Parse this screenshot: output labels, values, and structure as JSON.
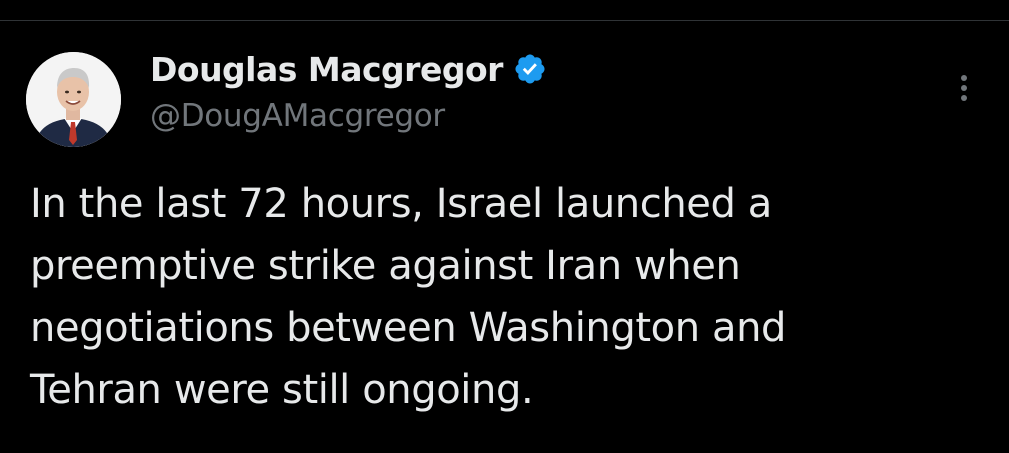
{
  "tweet": {
    "author": {
      "display_name": "Douglas Macgregor",
      "handle": "@DougAMacgregor",
      "verified": true,
      "avatar_icon": "profile-photo"
    },
    "text": "In the last 72 hours, Israel launched a\npreemptive strike against Iran when\nnegotiations between Washington and\nTehran were still ongoing.",
    "more_icon": "vertical-ellipsis-icon"
  },
  "colors": {
    "background": "#000000",
    "text_primary": "#e7e9ea",
    "text_secondary": "#71767b",
    "verified_badge": "#1d9bf0",
    "divider": "#2f3336"
  }
}
